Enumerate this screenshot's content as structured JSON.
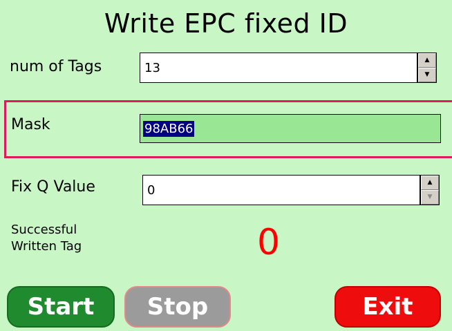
{
  "title": "Write EPC fixed ID",
  "num_tags": {
    "label": "num of Tags",
    "value": "13"
  },
  "mask": {
    "label": "Mask",
    "value": "98AB66"
  },
  "fix_q": {
    "label": "Fix Q Value",
    "value": "0"
  },
  "written": {
    "label_line1": "Successful",
    "label_line2": "Written Tag",
    "count": "0"
  },
  "buttons": {
    "start": "Start",
    "stop": "Stop",
    "exit": "Exit"
  },
  "spinner": {
    "up": "▲",
    "down": "▼"
  },
  "colors": {
    "background": "#c8f7c5",
    "mask_highlight": "#e0195c",
    "counter": "#ff0000",
    "start": "#1f8a2e",
    "stop": "#9b9b9b",
    "exit": "#ee0c0c"
  }
}
